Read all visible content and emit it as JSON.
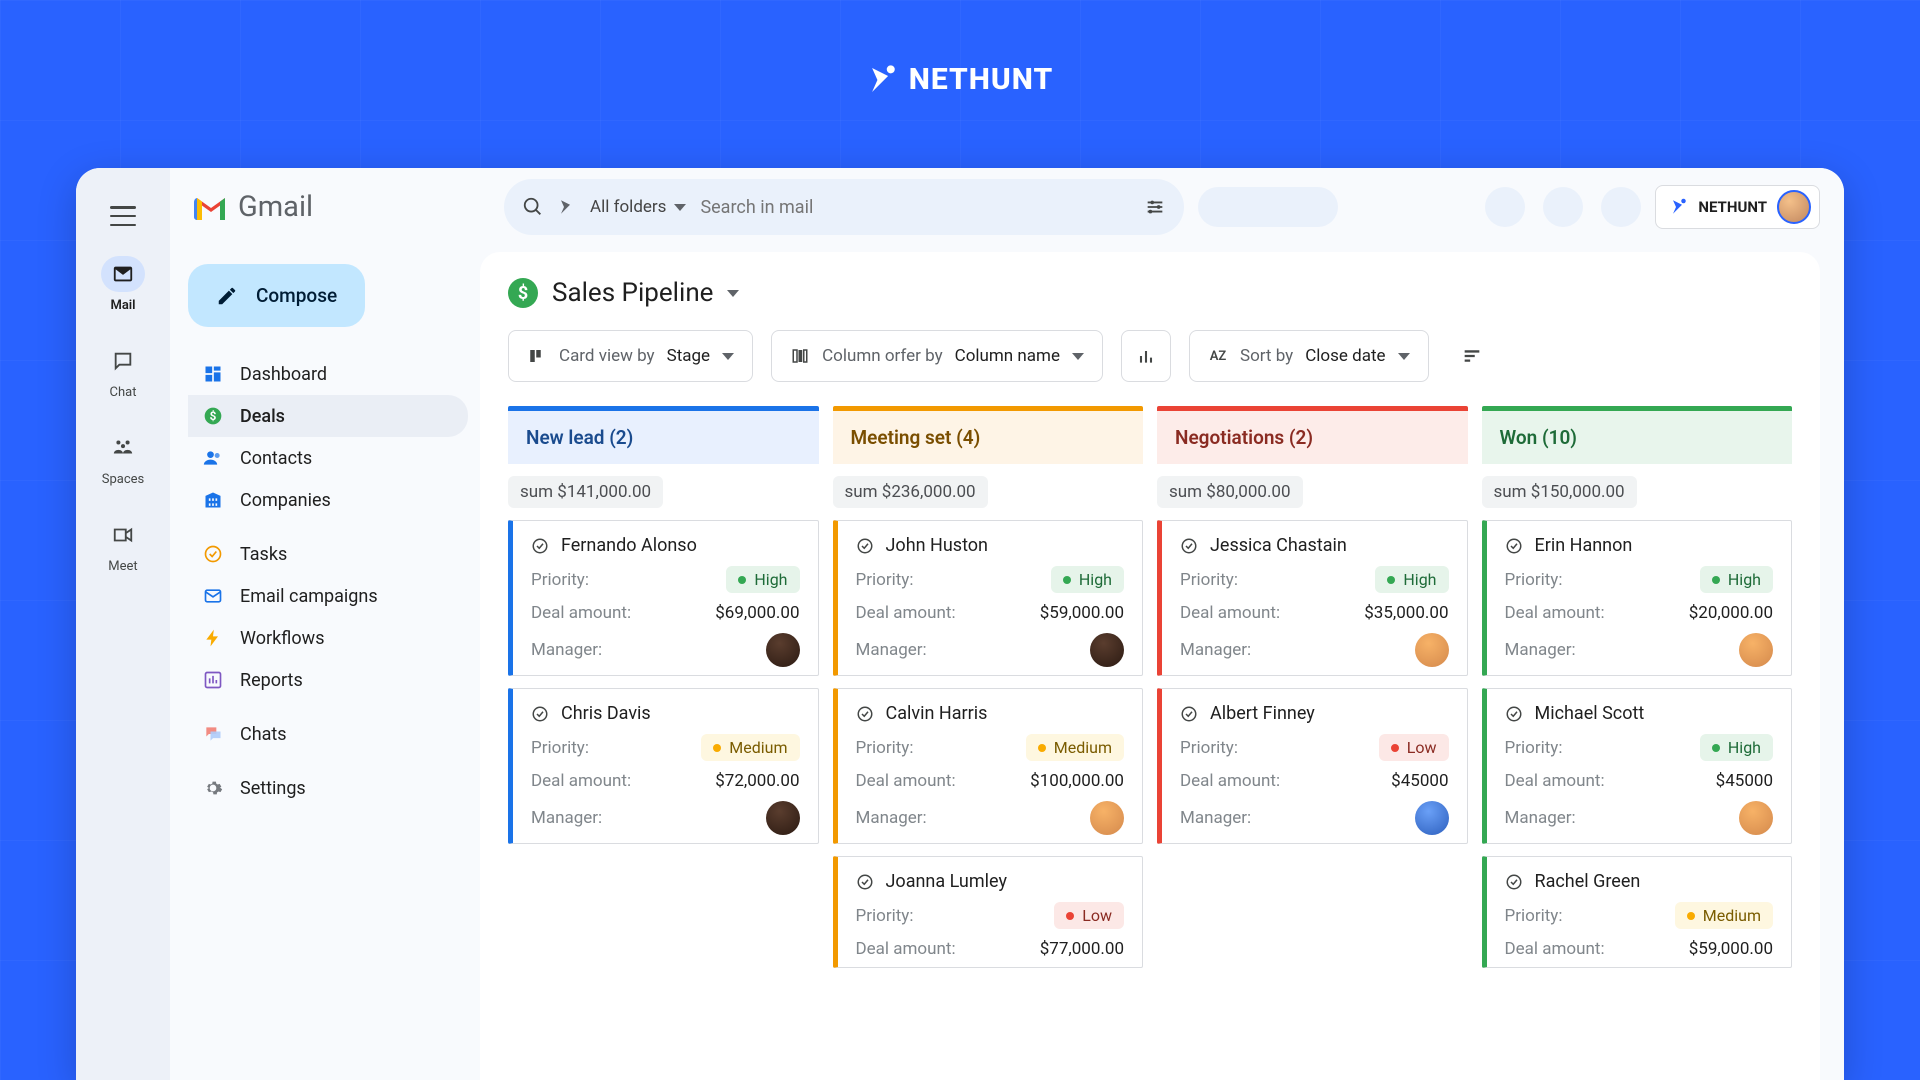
{
  "brand": {
    "name": "NETHUNT"
  },
  "gmail": {
    "name": "Gmail"
  },
  "compose": "Compose",
  "rail": {
    "mail": "Mail",
    "chat": "Chat",
    "spaces": "Spaces",
    "meet": "Meet"
  },
  "nav": {
    "dashboard": "Dashboard",
    "deals": "Deals",
    "contacts": "Contacts",
    "companies": "Companies",
    "tasks": "Tasks",
    "campaigns": "Email campaigns",
    "workflows": "Workflows",
    "reports": "Reports",
    "chats": "Chats",
    "settings": "Settings"
  },
  "search": {
    "folder": "All folders",
    "placeholder": "Search in mail"
  },
  "badge": {
    "text": "NETHUNT"
  },
  "title": "Sales Pipeline",
  "controls": {
    "cardview_prefix": "Card view by",
    "cardview_value": "Stage",
    "colorder_prefix": "Column orfer by",
    "colorder_value": "Column name",
    "sort_prefix": "Sort by",
    "sort_value": "Close date"
  },
  "labels": {
    "priority": "Priority:",
    "amount": "Deal amount:",
    "manager": "Manager:"
  },
  "columns": {
    "newlead": {
      "header": "New lead (2)",
      "sum": "sum $141,000.00"
    },
    "meeting": {
      "header": "Meeting set (4)",
      "sum": "sum $236,000.00"
    },
    "neg": {
      "header": "Negotiations (2)",
      "sum": "sum $80,000.00"
    },
    "won": {
      "header": "Won (10)",
      "sum": "sum $150,000.00"
    }
  },
  "cards": {
    "n1": {
      "name": "Fernando Alonso",
      "pri": "High",
      "amount": "$69,000.00"
    },
    "n2": {
      "name": "Chris Davis",
      "pri": "Medium",
      "amount": "$72,000.00"
    },
    "m1": {
      "name": "John Huston",
      "pri": "High",
      "amount": "$59,000.00"
    },
    "m2": {
      "name": "Calvin Harris",
      "pri": "Medium",
      "amount": "$100,000.00"
    },
    "m3": {
      "name": "Joanna Lumley",
      "pri": "Low",
      "amount": "$77,000.00"
    },
    "g1": {
      "name": "Jessica Chastain",
      "pri": "High",
      "amount": "$35,000.00"
    },
    "g2": {
      "name": "Albert Finney",
      "pri": "Low",
      "amount": "$45000"
    },
    "w1": {
      "name": "Erin Hannon",
      "pri": "High",
      "amount": "$20,000.00"
    },
    "w2": {
      "name": "Michael Scott",
      "pri": "High",
      "amount": "$45000"
    },
    "w3": {
      "name": "Rachel Green",
      "pri": "Medium",
      "amount": "$59,000.00"
    }
  }
}
